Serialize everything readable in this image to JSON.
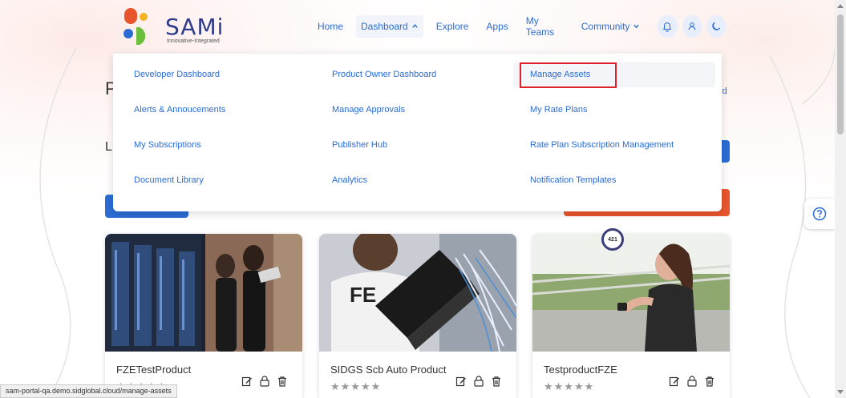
{
  "brand": {
    "name": "SAMi",
    "tagline": "Innovative-Integrated"
  },
  "nav": {
    "home": "Home",
    "dashboard": "Dashboard",
    "explore": "Explore",
    "apps": "Apps",
    "my_teams": "My Teams",
    "community": "Community"
  },
  "dropdown": {
    "col1": [
      "Developer Dashboard",
      "Alerts & Annoucements",
      "My Subscriptions",
      "Document Library"
    ],
    "col2": [
      "Product Owner Dashboard",
      "Manage Approvals",
      "Publisher Hub",
      "Analytics"
    ],
    "col3": [
      "Manage Assets",
      "My Rate Plans",
      "Rate Plan Subscription Management",
      "Notification Templates"
    ]
  },
  "background": {
    "heading_fragment": "P",
    "label_fragment": "L",
    "link_fragment": "rd"
  },
  "cards": [
    {
      "title": "FZETestProduct",
      "stars": "★★★★★"
    },
    {
      "title": "SIDGS Scb Auto Product",
      "stars": "★★★★★"
    },
    {
      "title": "TestproductFZE",
      "stars": "★★★★★"
    }
  ],
  "badge": "421",
  "status_url": "sam-portal-qa.demo.sidglobal.cloud/manage-assets",
  "colors": {
    "link": "#2b6cd4",
    "brand_navy": "#2e3a8c",
    "highlight_box": "#e0202a",
    "orange": "#e8552c"
  },
  "icons": [
    "bell-icon",
    "user-icon",
    "moon-icon",
    "help-icon",
    "edit-icon",
    "lock-icon",
    "trash-icon"
  ]
}
